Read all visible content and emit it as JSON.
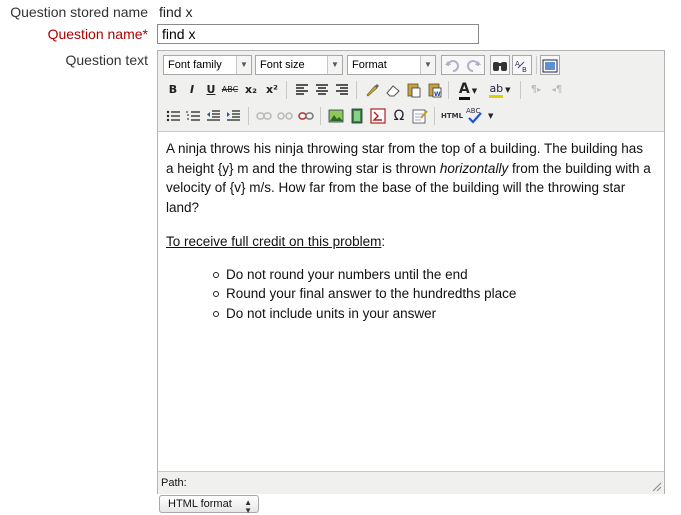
{
  "fields": {
    "stored_name_label": "Question stored name",
    "stored_name_value": "find x",
    "name_label": "Question name",
    "name_required_marker": "*",
    "name_value": "find x",
    "text_label": "Question text"
  },
  "toolbar": {
    "font_family": "Font family",
    "font_size": "Font size",
    "format": "Format",
    "undo_icon": "undo-icon",
    "redo_icon": "redo-icon",
    "find_icon": "find-icon",
    "replace_icon": "replace-icon",
    "fullscreen_icon": "fullscreen-icon",
    "bold": "B",
    "italic": "I",
    "underline": "U",
    "strike": "ABC",
    "subscript": "x₂",
    "superscript": "x²",
    "text_color": "A",
    "highlight": "ab",
    "ltr_label": "¶",
    "rtl_label": "¶",
    "omega": "Ω",
    "html_label": "HTML",
    "spell_label": "ABC"
  },
  "content": {
    "paragraph_part1": "A ninja throws his ninja throwing star from the top of a building. The building has a height {y} m and the throwing star is thrown ",
    "paragraph_italic": "horizontally",
    "paragraph_part2": " from the building with a velocity of {v} m/s. How far from the base of the building will the throwing star land?",
    "credit_heading": "To receive full credit on this problem",
    "credit_colon": ":",
    "bullets": [
      "Do not round your numbers until the end",
      "Round your final answer to the hundredths place",
      "Do not include units in your answer"
    ]
  },
  "path_label": "Path:",
  "format_select": "HTML format",
  "colors": {
    "required": "#b00000",
    "toolbar_bg": "#f0f0ee",
    "border": "#b3b3b3"
  }
}
